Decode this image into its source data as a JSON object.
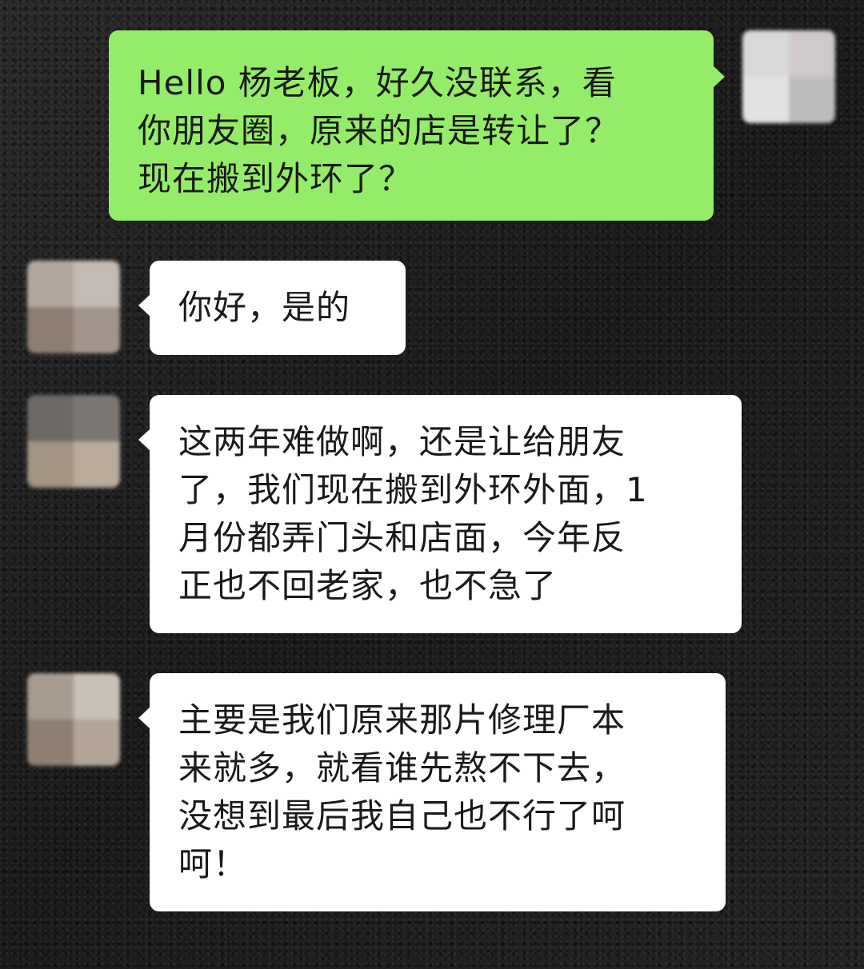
{
  "messages": [
    {
      "side": "outgoing",
      "lines": [
        "Hello 杨老板，好久没联系，看",
        "你朋友圈，原来的店是转让了？",
        "现在搬到外环了？"
      ],
      "bubble_color": "#95ec69"
    },
    {
      "side": "incoming",
      "lines": [
        "你好，是的"
      ],
      "bubble_color": "#ffffff"
    },
    {
      "side": "incoming",
      "lines": [
        "这两年难做啊，还是让给朋友",
        "了，我们现在搬到外环外面，1",
        "月份都弄门头和店面，今年反",
        "正也不回老家，也不急了"
      ],
      "bubble_color": "#ffffff"
    },
    {
      "side": "incoming",
      "lines": [
        "主要是我们原来那片修理厂本",
        "来就多，就看谁先熬不下去，",
        "没想到最后我自己也不行了呵",
        "呵！"
      ],
      "bubble_color": "#ffffff"
    }
  ]
}
